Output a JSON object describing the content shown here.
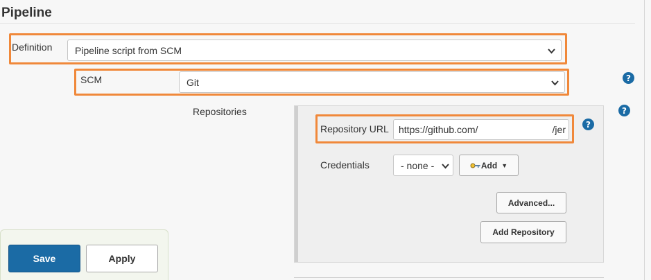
{
  "section": {
    "title": "Pipeline"
  },
  "definition": {
    "label": "Definition",
    "value": "Pipeline script from SCM"
  },
  "scm": {
    "label": "SCM",
    "value": "Git"
  },
  "repositories": {
    "label": "Repositories",
    "repo_url": {
      "label": "Repository URL",
      "value": "https://github.com/",
      "suffix": "/jer"
    },
    "credentials": {
      "label": "Credentials",
      "value": "- none -",
      "add_label": "Add"
    },
    "advanced_label": "Advanced...",
    "add_repository_label": "Add Repository"
  },
  "help": {
    "glyph": "?"
  },
  "footer": {
    "save_label": "Save",
    "apply_label": "Apply"
  },
  "colors": {
    "highlight": "#f0883a",
    "primary": "#1b6ba5"
  }
}
